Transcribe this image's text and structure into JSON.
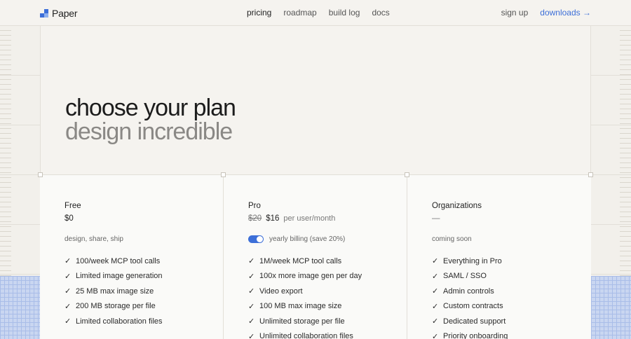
{
  "header": {
    "logo_text": "Paper",
    "nav": [
      "pricing",
      "roadmap",
      "build log",
      "docs"
    ],
    "signup_label": "sign up",
    "downloads_label": "downloads →"
  },
  "hero": {
    "headline": "choose your plan",
    "subheadline": "design incredible"
  },
  "plans": [
    {
      "name": "Free",
      "price": "$0",
      "subtitle": "design, share, ship",
      "features": [
        "100/week MCP tool calls",
        "Limited image generation",
        "25 MB max image size",
        "200 MB storage per file",
        "Limited collaboration files"
      ]
    },
    {
      "name": "Pro",
      "old_price": "$20",
      "price": "$16",
      "price_unit": "per user/month",
      "billing_toggle_label": "yearly billing (save 20%)",
      "billing_toggle_on": true,
      "features": [
        "1M/week MCP tool calls",
        "100x more image gen per day",
        "Video export",
        "100 MB max image size",
        "Unlimited storage per file",
        "Unlimited collaboration files"
      ]
    },
    {
      "name": "Organizations",
      "price": "—",
      "subtitle": "coming soon",
      "features": [
        "Everything in Pro",
        "SAML / SSO",
        "Admin controls",
        "Custom contracts",
        "Dedicated support",
        "Priority onboarding"
      ]
    }
  ],
  "colors": {
    "accent": "#3d6fd8",
    "background": "#f3f1ec",
    "card_background": "#fafaf8",
    "grid_blue": "#c9d6f1"
  }
}
